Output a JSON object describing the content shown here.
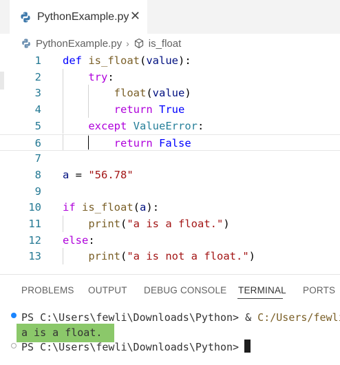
{
  "tab": {
    "filename": "PythonExample.py",
    "close_symbol": "✕",
    "icon": "python-file-icon"
  },
  "breadcrumb": {
    "file": "PythonExample.py",
    "separator": "›",
    "symbol": "is_float",
    "symbol_icon": "cube-symbol-icon"
  },
  "editor": {
    "current_line": 6,
    "lines": [
      {
        "number": "1",
        "tokens": [
          [
            "kw",
            "def"
          ],
          [
            "",
            " "
          ],
          [
            "fn",
            "is_float"
          ],
          [
            "",
            "("
          ],
          [
            "param",
            "value"
          ],
          [
            "",
            "):"
          ]
        ]
      },
      {
        "number": "2",
        "tokens": [
          [
            "",
            "    "
          ],
          [
            "kw2",
            "try"
          ],
          [
            "",
            ":"
          ]
        ]
      },
      {
        "number": "3",
        "tokens": [
          [
            "",
            "        "
          ],
          [
            "fn",
            "float"
          ],
          [
            "",
            "("
          ],
          [
            "param",
            "value"
          ],
          [
            "",
            ")"
          ]
        ]
      },
      {
        "number": "4",
        "tokens": [
          [
            "",
            "        "
          ],
          [
            "kw2",
            "return"
          ],
          [
            "",
            " "
          ],
          [
            "kw",
            "True"
          ]
        ]
      },
      {
        "number": "5",
        "tokens": [
          [
            "",
            "    "
          ],
          [
            "kw2",
            "except"
          ],
          [
            "",
            " "
          ],
          [
            "cls",
            "ValueError"
          ],
          [
            "",
            ":"
          ]
        ]
      },
      {
        "number": "6",
        "tokens": [
          [
            "",
            "        "
          ],
          [
            "kw2",
            "return"
          ],
          [
            "",
            " "
          ],
          [
            "kw",
            "False"
          ]
        ]
      },
      {
        "number": "7",
        "tokens": []
      },
      {
        "number": "8",
        "tokens": [
          [
            "param",
            "a"
          ],
          [
            "",
            " = "
          ],
          [
            "str",
            "\"56.78\""
          ]
        ]
      },
      {
        "number": "9",
        "tokens": []
      },
      {
        "number": "10",
        "tokens": [
          [
            "kw2",
            "if"
          ],
          [
            "",
            " "
          ],
          [
            "fn",
            "is_float"
          ],
          [
            "",
            "("
          ],
          [
            "param",
            "a"
          ],
          [
            "",
            "):"
          ]
        ]
      },
      {
        "number": "11",
        "tokens": [
          [
            "",
            "    "
          ],
          [
            "fn",
            "print"
          ],
          [
            "",
            "("
          ],
          [
            "str",
            "\"a is a float.\""
          ],
          [
            "",
            ")"
          ]
        ]
      },
      {
        "number": "12",
        "tokens": [
          [
            "kw2",
            "else"
          ],
          [
            "",
            ":"
          ]
        ]
      },
      {
        "number": "13",
        "tokens": [
          [
            "",
            "    "
          ],
          [
            "fn",
            "print"
          ],
          [
            "",
            "("
          ],
          [
            "str",
            "\"a is not a float.\""
          ],
          [
            "",
            ")"
          ]
        ]
      }
    ]
  },
  "panel": {
    "tabs": [
      "PROBLEMS",
      "OUTPUT",
      "DEBUG CONSOLE",
      "TERMINAL",
      "PORTS"
    ],
    "active_tab": "TERMINAL"
  },
  "terminal": {
    "prompt1": "PS C:\\Users\\fewli\\Downloads\\Python> ",
    "command_amp": "& ",
    "command_path": "C:/Users/fewli",
    "output": "a is a float.",
    "prompt2": "PS C:\\Users\\fewli\\Downloads\\Python> "
  },
  "colors": {
    "keyword": "#0000ff",
    "control": "#af00db",
    "function": "#795e26",
    "string": "#a31515",
    "line_number": "#237893",
    "highlight": "#8bc86a"
  }
}
